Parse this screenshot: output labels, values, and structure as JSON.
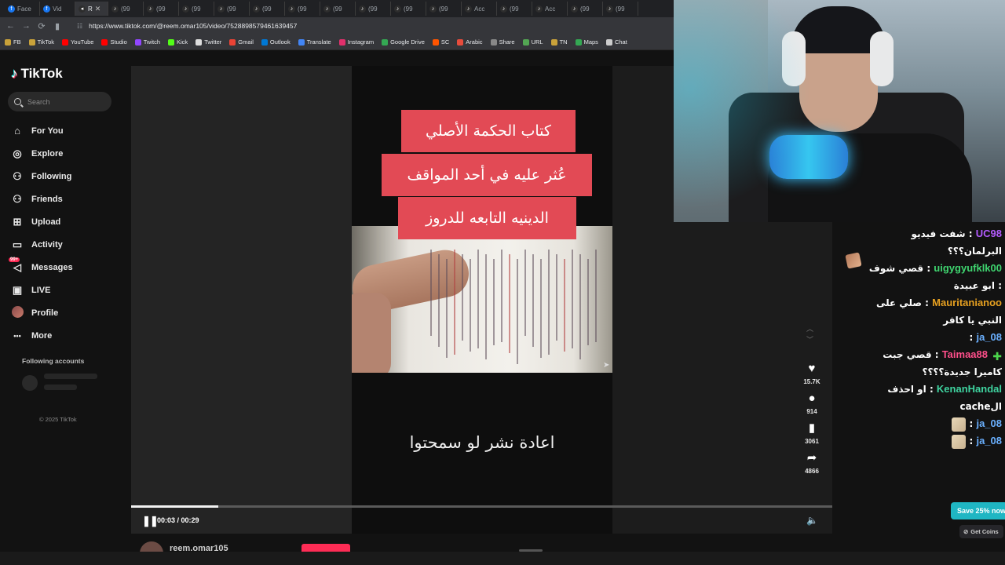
{
  "browser": {
    "tabs": [
      {
        "label": "Face",
        "icon": "facebook-icon"
      },
      {
        "label": "Vid",
        "icon": "facebook-icon"
      },
      {
        "label": "R",
        "icon": "audio-icon",
        "active": true
      },
      {
        "label": "(99",
        "icon": "tiktok-icon"
      },
      {
        "label": "(99",
        "icon": "tiktok-icon"
      },
      {
        "label": "(99",
        "icon": "tiktok-icon"
      },
      {
        "label": "(99",
        "icon": "tiktok-icon"
      },
      {
        "label": "(99",
        "icon": "tiktok-icon"
      },
      {
        "label": "(99",
        "icon": "tiktok-icon"
      },
      {
        "label": "(99",
        "icon": "tiktok-icon"
      },
      {
        "label": "(99",
        "icon": "tiktok-icon"
      },
      {
        "label": "(99",
        "icon": "tiktok-icon"
      },
      {
        "label": "(99",
        "icon": "tiktok-icon"
      },
      {
        "label": "Acc",
        "icon": "tiktok-icon"
      },
      {
        "label": "(99",
        "icon": "tiktok-icon"
      },
      {
        "label": "Acc",
        "icon": "tiktok-icon"
      },
      {
        "label": "(99",
        "icon": "tiktok-icon"
      },
      {
        "label": "(99",
        "icon": "tiktok-icon"
      }
    ],
    "url": "https://www.tiktok.com/@reem.omar105/video/7528898579461639457",
    "bookmarks": [
      {
        "label": "FB",
        "color": "#c9a23a"
      },
      {
        "label": "TikTok",
        "color": "#c9a23a"
      },
      {
        "label": "YouTube",
        "color": "#ff0000"
      },
      {
        "label": "Studio",
        "color": "#ff0000"
      },
      {
        "label": "Twitch",
        "color": "#9146ff"
      },
      {
        "label": "Kick",
        "color": "#53fc18"
      },
      {
        "label": "Twitter",
        "color": "#dddddd"
      },
      {
        "label": "Gmail",
        "color": "#ea4335"
      },
      {
        "label": "Outlook",
        "color": "#0078d4"
      },
      {
        "label": "Translate",
        "color": "#4285f4"
      },
      {
        "label": "Instagram",
        "color": "#e1306c"
      },
      {
        "label": "Google Drive",
        "color": "#34a853"
      },
      {
        "label": "SC",
        "color": "#ff5500"
      },
      {
        "label": "Arabic",
        "color": "#e74c3c"
      },
      {
        "label": "Share",
        "color": "#888888"
      },
      {
        "label": "URL",
        "color": "#53a653"
      },
      {
        "label": "TN",
        "color": "#c9a23a"
      },
      {
        "label": "Maps",
        "color": "#34a853"
      },
      {
        "label": "Chat",
        "color": "#cccccc"
      }
    ]
  },
  "tiktok": {
    "logo": "TikTok",
    "search_placeholder": "Search",
    "nav": [
      {
        "label": "For You",
        "icon": "home-icon"
      },
      {
        "label": "Explore",
        "icon": "compass-icon"
      },
      {
        "label": "Following",
        "icon": "following-icon"
      },
      {
        "label": "Friends",
        "icon": "friends-icon"
      },
      {
        "label": "Upload",
        "icon": "upload-icon"
      },
      {
        "label": "Activity",
        "icon": "activity-icon"
      },
      {
        "label": "Messages",
        "icon": "messages-icon",
        "badge": "99+"
      },
      {
        "label": "LIVE",
        "icon": "live-icon"
      },
      {
        "label": "Profile",
        "icon": "profile-avatar"
      },
      {
        "label": "More",
        "icon": "more-icon"
      }
    ],
    "following_title": "Following accounts",
    "copyright": "© 2025 TikTok"
  },
  "video": {
    "caption_lines": [
      "كتاب الحكمة الأصلي",
      "عُثر عليه في أحد  المواقف",
      "الدينيه  التابعه للدروز"
    ],
    "bottom_caption": "اعادة نشر لو سمحتوا",
    "time": "00:03 / 00:29",
    "progress": 0.124,
    "author": "reem.omar105",
    "accent": "#fe2c55"
  },
  "actions": [
    {
      "icon": "heart-icon",
      "count": "15.7K"
    },
    {
      "icon": "comment-icon",
      "count": "914"
    },
    {
      "icon": "bookmark-icon",
      "count": "3061"
    },
    {
      "icon": "share-icon",
      "count": "4866"
    }
  ],
  "chat": [
    {
      "user": "UC98",
      "color": "#b45cff",
      "text": "شفت فيديو البرلمان؟؟؟"
    },
    {
      "user": "uigygyufklk00",
      "color": "#3fd46f",
      "text": "قصي شوف : ابو عبيدة"
    },
    {
      "user": "Mauritanianoo",
      "color": "#e6a020",
      "text": "صلي على النبي يا كافر"
    },
    {
      "user": "ja_08",
      "color": "#6ab0ff",
      "text": "",
      "emote": "hand"
    },
    {
      "user": "Taimaa88",
      "color": "#ff4f8b",
      "text": "قصي جبت كاميرا جديدة؟؟؟؟",
      "badge": "plus"
    },
    {
      "user": "KenanHandal",
      "color": "#3fd4a0",
      "text": "او احذف الcache"
    },
    {
      "user": "ja_08",
      "color": "#6ab0ff",
      "text": "",
      "emote": "face"
    },
    {
      "user": "ja_08",
      "color": "#6ab0ff",
      "text": "",
      "emote": "face"
    }
  ],
  "promo": {
    "save_label": "Save 25% now",
    "coins_label": "Get Coins"
  }
}
